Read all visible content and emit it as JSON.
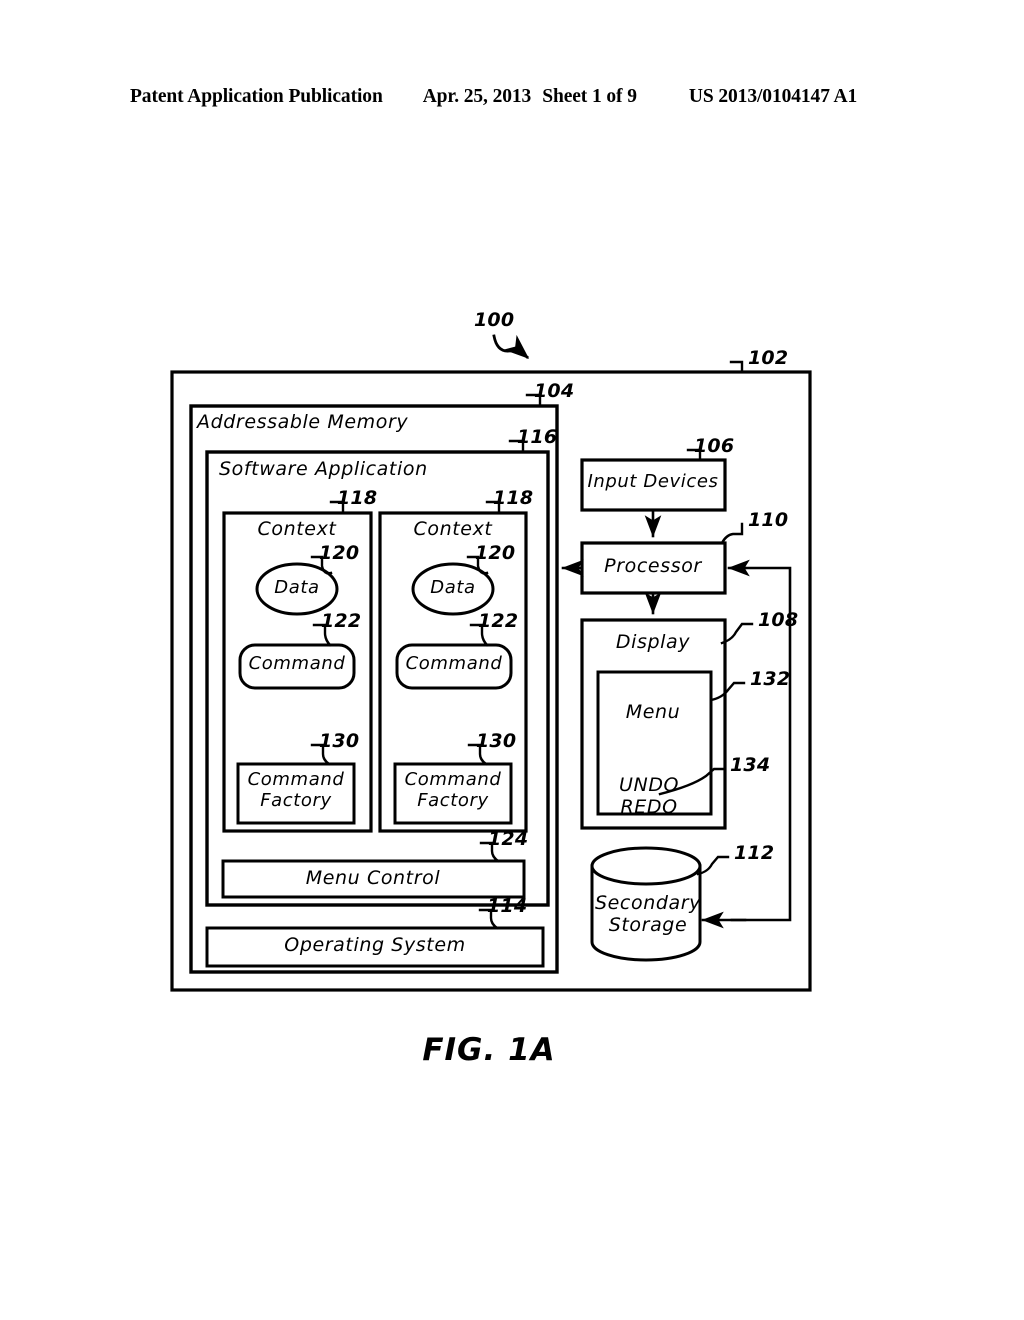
{
  "header": {
    "publication": "Patent Application Publication",
    "date": "Apr. 25, 2013",
    "sheet": "Sheet 1 of 9",
    "patent_number": "US 2013/0104147 A1"
  },
  "figure": {
    "caption": "FIG. 1A",
    "system_ref": "100",
    "blocks": {
      "computer": {
        "ref": "102"
      },
      "addressable_memory": {
        "label": "Addressable Memory",
        "ref": "104"
      },
      "software_application": {
        "label": "Software Application",
        "ref": "116"
      },
      "context_left": {
        "label": "Context",
        "ref": "118"
      },
      "context_right": {
        "label": "Context",
        "ref": "118"
      },
      "data_left": {
        "label": "Data",
        "ref": "120"
      },
      "data_right": {
        "label": "Data",
        "ref": "120"
      },
      "command_left": {
        "label": "Command",
        "ref": "122"
      },
      "command_right": {
        "label": "Command",
        "ref": "122"
      },
      "command_factory_left": {
        "label_line1": "Command",
        "label_line2": "Factory",
        "ref": "130"
      },
      "command_factory_right": {
        "label_line1": "Command",
        "label_line2": "Factory",
        "ref": "130"
      },
      "menu_control": {
        "label": "Menu Control",
        "ref": "124"
      },
      "operating_system": {
        "label": "Operating System",
        "ref": "114"
      },
      "input_devices": {
        "label": "Input Devices",
        "ref": "106"
      },
      "processor": {
        "label": "Processor",
        "ref": "110"
      },
      "display": {
        "label": "Display",
        "ref": "108"
      },
      "menu": {
        "label": "Menu",
        "ref": "132"
      },
      "undo_redo": {
        "label_line1": "UNDO",
        "label_line2": "REDO",
        "ref": "134"
      },
      "secondary_storage": {
        "label_line1": "Secondary",
        "label_line2": "Storage",
        "ref": "112"
      }
    }
  },
  "colors": {
    "ink": "#000000",
    "paper": "#ffffff"
  }
}
